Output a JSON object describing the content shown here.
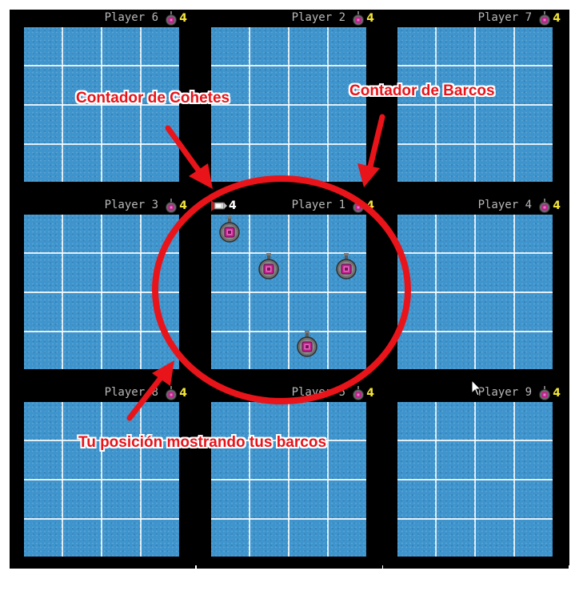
{
  "colors": {
    "board": "#000000",
    "water": "#3e94cc",
    "gridline": "#ffffff",
    "count_yellow": "#f2e33a",
    "label_gray": "#b8b8b8",
    "annotation_red": "#e8141a"
  },
  "cells": [
    {
      "name": "Player 6",
      "ships": "4"
    },
    {
      "name": "Player 2",
      "ships": "4"
    },
    {
      "name": "Player 7",
      "ships": "4"
    },
    {
      "name": "Player 3",
      "ships": "4"
    },
    {
      "name": "Player 1",
      "ships": "4",
      "rockets": "4"
    },
    {
      "name": "Player 4",
      "ships": "4"
    },
    {
      "name": "Player 8",
      "ships": "4"
    },
    {
      "name": "Player 5",
      "ships": "4"
    },
    {
      "name": "Player 9",
      "ships": "4"
    }
  ],
  "annotations": {
    "rocket_counter": "Contador de Cohetes",
    "ship_counter": "Contador de Barcos",
    "your_position": "Tu posición mostrando tus barcos"
  },
  "icons": {
    "ship": "submarine-icon",
    "rocket": "rocket-icon",
    "cursor": "mouse-cursor-icon"
  }
}
